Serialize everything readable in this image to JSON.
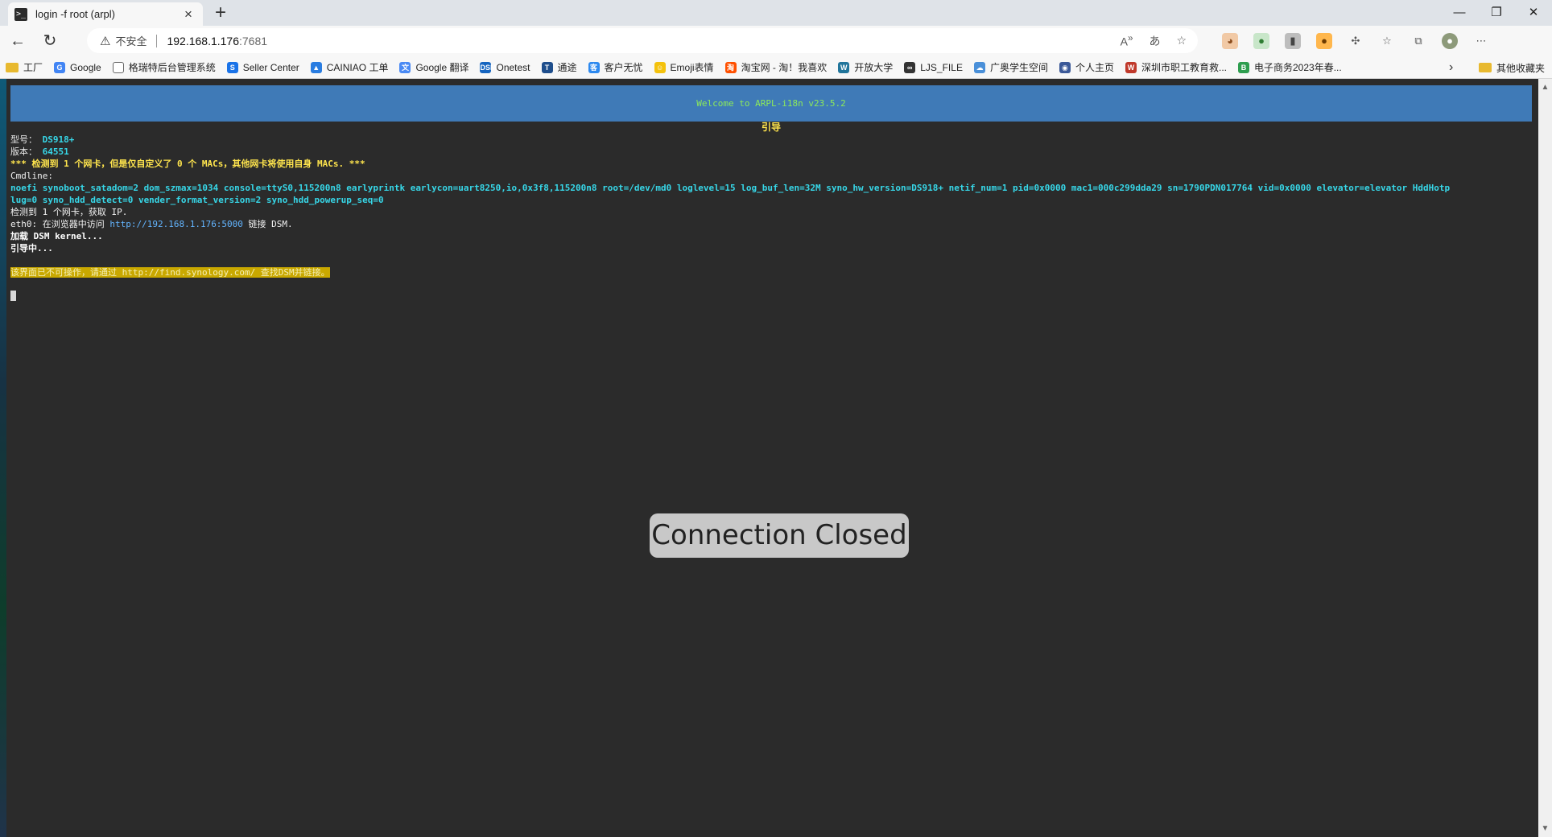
{
  "browser": {
    "tab_title": "login -f root (arpl)",
    "tab_icon": "terminal-icon",
    "address": {
      "security_label": "不安全",
      "host": "192.168.1.176",
      "port": ":7681"
    },
    "bookmarks": [
      {
        "label": "工厂",
        "icon": "folder-icon",
        "color": "#e8b92f"
      },
      {
        "label": "Google",
        "icon": "G",
        "color": "#4285f4"
      },
      {
        "label": "格瑞特后台管理系统",
        "icon": "page-icon",
        "color": "#666666"
      },
      {
        "label": "Seller Center",
        "icon": "S",
        "color": "#1a73e8"
      },
      {
        "label": "CAINIAO 工单",
        "icon": "▲",
        "color": "#2a7de1"
      },
      {
        "label": "Google 翻译",
        "icon": "文",
        "color": "#4a8af4"
      },
      {
        "label": "Onetest",
        "icon": "DSM",
        "color": "#1565c0"
      },
      {
        "label": "通途",
        "icon": "T",
        "color": "#1e4e8c"
      },
      {
        "label": "客户无忧",
        "icon": "客",
        "color": "#2d89ef"
      },
      {
        "label": "Emoji表情",
        "icon": "☺",
        "color": "#f4c20d"
      },
      {
        "label": "淘宝网 - 淘！我喜欢",
        "icon": "淘",
        "color": "#ff5000"
      },
      {
        "label": "开放大学",
        "icon": "W",
        "color": "#21759b"
      },
      {
        "label": "LJS_FILE",
        "icon": "∞",
        "color": "#333333"
      },
      {
        "label": "广奥学生空间",
        "icon": "☁",
        "color": "#4a90d9"
      },
      {
        "label": "个人主页",
        "icon": "◉",
        "color": "#3b5998"
      },
      {
        "label": "深圳市职工教育救...",
        "icon": "W",
        "color": "#c0392b"
      },
      {
        "label": "电子商务2023年春...",
        "icon": "B",
        "color": "#2e9e4f"
      }
    ],
    "other_bookmarks": "其他收藏夹"
  },
  "terminal": {
    "banner": "Welcome to ARPL-i18n v23.5.2",
    "menu_title": "引导",
    "model_label": "型号：",
    "model_value": "DS918+",
    "build_label": "版本：",
    "build_value": "64551",
    "mac_warning": "*** 检测到 1 个网卡，但是仅自定义了 0 个 MACs，其他网卡将使用自身 MACs. ***",
    "cmdline_label": "Cmdline:",
    "cmdline_1": "noefi synoboot_satadom=2 dom_szmax=1034 console=ttyS0,115200n8 earlyprintk earlycon=uart8250,io,0x3f8,115200n8 root=/dev/md0 loglevel=15 log_buf_len=32M syno_hw_version=DS918+ netif_num=1 pid=0x0000 mac1=000c299dda29 sn=1790PDN017764 vid=0x0000 elevator=elevator HddHotp",
    "cmdline_2": "lug=0 syno_hdd_detect=0 vender_format_version=2 syno_hdd_powerup_seq=0",
    "nic_detect": "检测到 1 个网卡，获取 IP.",
    "eth_prefix": "eth0: 在浏览器中访问 ",
    "eth_url": "http://192.168.1.176:5000",
    "eth_suffix": " 链接 DSM.",
    "loading": "加载 DSM kernel...",
    "booting": "引导中...",
    "notice": "该界面已不可操作，请通过 http://find.synology.com/ 查找DSM并链接。"
  },
  "overlay": {
    "message": "Connection Closed"
  }
}
